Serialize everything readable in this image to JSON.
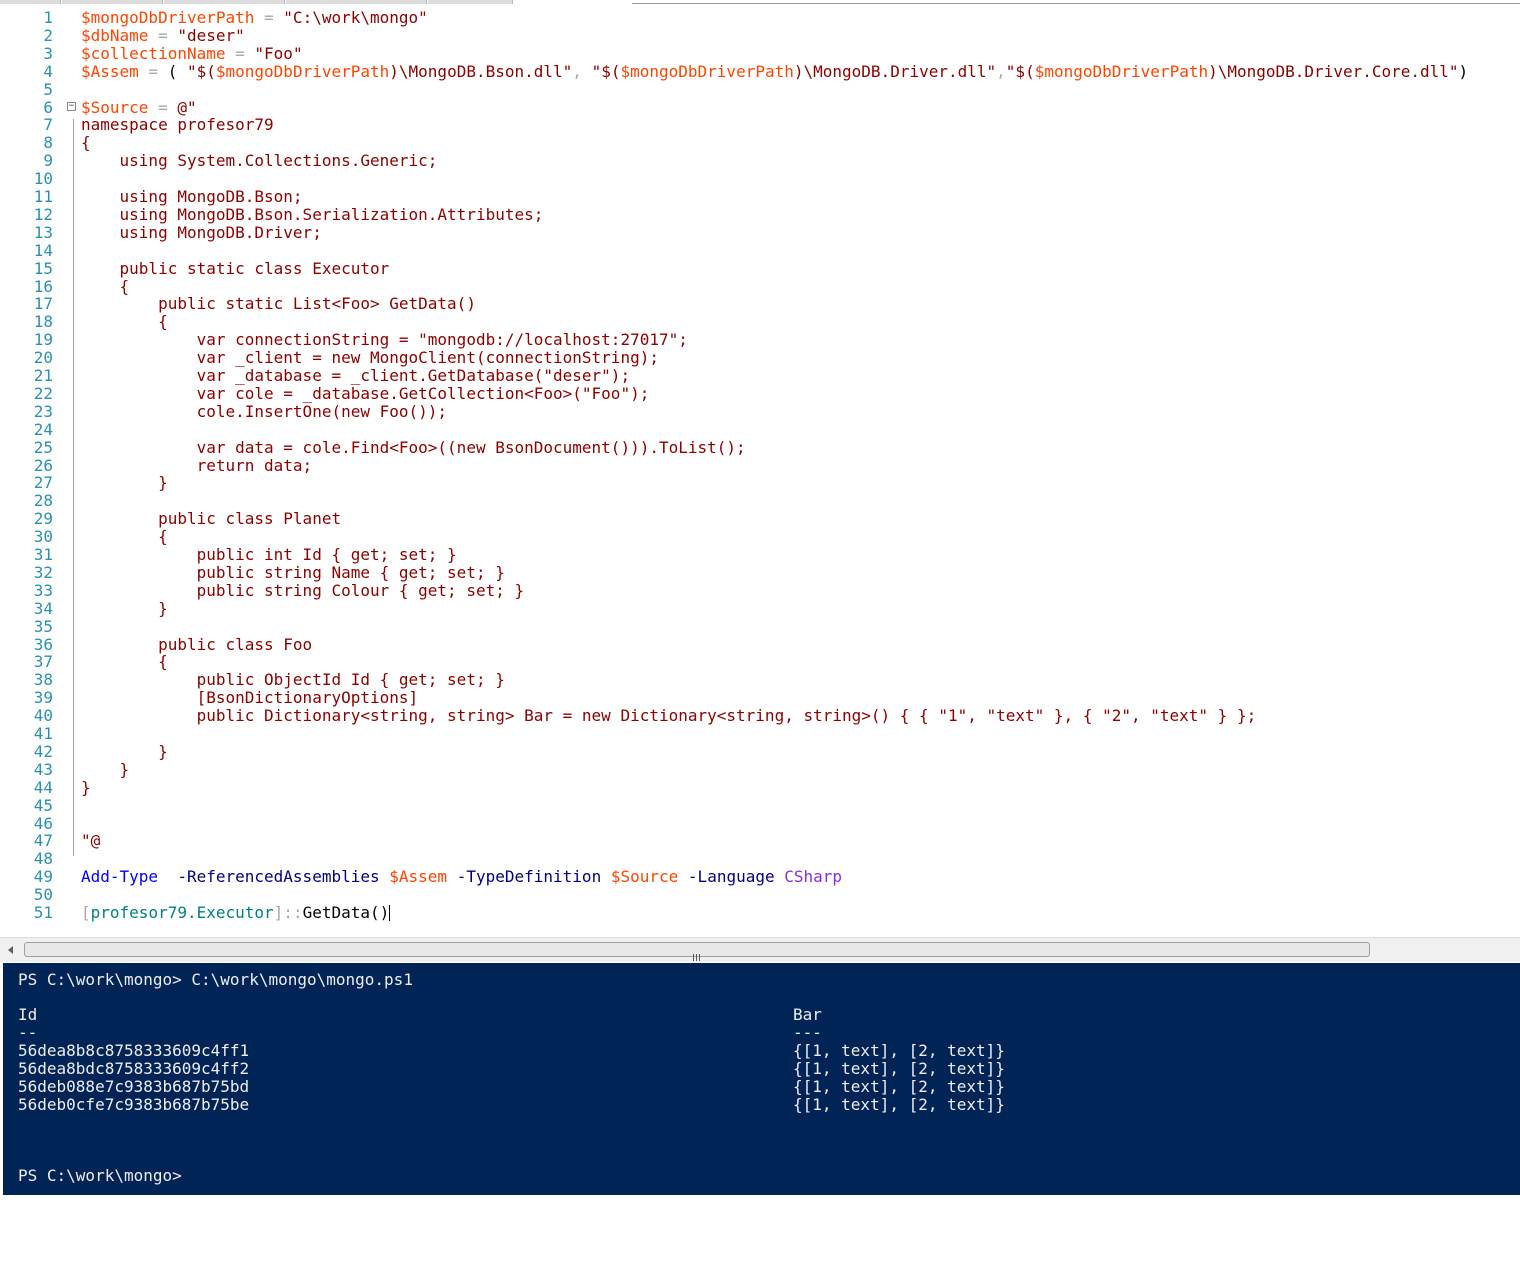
{
  "editor": {
    "lines": [
      {
        "n": "1",
        "t": [
          [
            "var",
            "$mongoDbDriverPath"
          ],
          [
            "op",
            " = "
          ],
          [
            "str",
            "\"C:\\work\\mongo\""
          ]
        ]
      },
      {
        "n": "2",
        "t": [
          [
            "var",
            "$dbName"
          ],
          [
            "op",
            " = "
          ],
          [
            "str",
            "\"deser\""
          ]
        ]
      },
      {
        "n": "3",
        "t": [
          [
            "var",
            "$collectionName"
          ],
          [
            "op",
            " = "
          ],
          [
            "str",
            "\"Foo\""
          ]
        ]
      },
      {
        "n": "4",
        "t": [
          [
            "var",
            "$Assem"
          ],
          [
            "op",
            " = "
          ],
          [
            "plain",
            "( "
          ],
          [
            "str",
            "\"$("
          ],
          [
            "var",
            "$mongoDbDriverPath"
          ],
          [
            "str",
            ")\\MongoDB.Bson.dll\""
          ],
          [
            "op",
            ", "
          ],
          [
            "str",
            "\"$("
          ],
          [
            "var",
            "$mongoDbDriverPath"
          ],
          [
            "str",
            ")\\MongoDB.Driver.dll\""
          ],
          [
            "op",
            ","
          ],
          [
            "str",
            "\"$("
          ],
          [
            "var",
            "$mongoDbDriverPath"
          ],
          [
            "str",
            ")\\MongoDB.Driver.Core.dll\""
          ],
          [
            "plain",
            ")"
          ]
        ]
      },
      {
        "n": "5",
        "t": []
      },
      {
        "n": "6",
        "t": [
          [
            "var",
            "$Source"
          ],
          [
            "op",
            " = "
          ],
          [
            "here",
            "@\""
          ]
        ]
      },
      {
        "n": "7",
        "t": [
          [
            "here",
            "namespace profesor79"
          ]
        ]
      },
      {
        "n": "8",
        "t": [
          [
            "here",
            "{"
          ]
        ]
      },
      {
        "n": "9",
        "t": [
          [
            "here",
            "    using System.Collections.Generic;"
          ]
        ]
      },
      {
        "n": "10",
        "t": []
      },
      {
        "n": "11",
        "t": [
          [
            "here",
            "    using MongoDB.Bson;"
          ]
        ]
      },
      {
        "n": "12",
        "t": [
          [
            "here",
            "    using MongoDB.Bson.Serialization.Attributes;"
          ]
        ]
      },
      {
        "n": "13",
        "t": [
          [
            "here",
            "    using MongoDB.Driver;"
          ]
        ]
      },
      {
        "n": "14",
        "t": []
      },
      {
        "n": "15",
        "t": [
          [
            "here",
            "    public static class Executor"
          ]
        ]
      },
      {
        "n": "16",
        "t": [
          [
            "here",
            "    {"
          ]
        ]
      },
      {
        "n": "17",
        "t": [
          [
            "here",
            "        public static List<Foo> GetData()"
          ]
        ]
      },
      {
        "n": "18",
        "t": [
          [
            "here",
            "        {"
          ]
        ]
      },
      {
        "n": "19",
        "t": [
          [
            "here",
            "            var connectionString = \"mongodb://localhost:27017\";"
          ]
        ]
      },
      {
        "n": "20",
        "t": [
          [
            "here",
            "            var _client = new MongoClient(connectionString);"
          ]
        ]
      },
      {
        "n": "21",
        "t": [
          [
            "here",
            "            var _database = _client.GetDatabase(\"deser\");"
          ]
        ]
      },
      {
        "n": "22",
        "t": [
          [
            "here",
            "            var cole = _database.GetCollection<Foo>(\"Foo\");"
          ]
        ]
      },
      {
        "n": "23",
        "t": [
          [
            "here",
            "            cole.InsertOne(new Foo());"
          ]
        ]
      },
      {
        "n": "24",
        "t": []
      },
      {
        "n": "25",
        "t": [
          [
            "here",
            "            var data = cole.Find<Foo>((new BsonDocument())).ToList();"
          ]
        ]
      },
      {
        "n": "26",
        "t": [
          [
            "here",
            "            return data;"
          ]
        ]
      },
      {
        "n": "27",
        "t": [
          [
            "here",
            "        }"
          ]
        ]
      },
      {
        "n": "28",
        "t": []
      },
      {
        "n": "29",
        "t": [
          [
            "here",
            "        public class Planet"
          ]
        ]
      },
      {
        "n": "30",
        "t": [
          [
            "here",
            "        {"
          ]
        ]
      },
      {
        "n": "31",
        "t": [
          [
            "here",
            "            public int Id { get; set; }"
          ]
        ]
      },
      {
        "n": "32",
        "t": [
          [
            "here",
            "            public string Name { get; set; }"
          ]
        ]
      },
      {
        "n": "33",
        "t": [
          [
            "here",
            "            public string Colour { get; set; }"
          ]
        ]
      },
      {
        "n": "34",
        "t": [
          [
            "here",
            "        }"
          ]
        ]
      },
      {
        "n": "35",
        "t": []
      },
      {
        "n": "36",
        "t": [
          [
            "here",
            "        public class Foo"
          ]
        ]
      },
      {
        "n": "37",
        "t": [
          [
            "here",
            "        {"
          ]
        ]
      },
      {
        "n": "38",
        "t": [
          [
            "here",
            "            public ObjectId Id { get; set; }"
          ]
        ]
      },
      {
        "n": "39",
        "t": [
          [
            "here",
            "            [BsonDictionaryOptions]"
          ]
        ]
      },
      {
        "n": "40",
        "t": [
          [
            "here",
            "            public Dictionary<string, string> Bar = new Dictionary<string, string>() { { \"1\", \"text\" }, { \"2\", \"text\" } };"
          ]
        ]
      },
      {
        "n": "41",
        "t": []
      },
      {
        "n": "42",
        "t": [
          [
            "here",
            "        }"
          ]
        ]
      },
      {
        "n": "43",
        "t": [
          [
            "here",
            "    }"
          ]
        ]
      },
      {
        "n": "44",
        "t": [
          [
            "here",
            "}"
          ]
        ]
      },
      {
        "n": "45",
        "t": []
      },
      {
        "n": "46",
        "t": []
      },
      {
        "n": "47",
        "t": [
          [
            "here",
            "\"@"
          ]
        ]
      },
      {
        "n": "48",
        "t": []
      },
      {
        "n": "49",
        "t": [
          [
            "cmd",
            "Add-Type"
          ],
          [
            "plain",
            "  "
          ],
          [
            "param",
            "-ReferencedAssemblies"
          ],
          [
            "plain",
            " "
          ],
          [
            "var",
            "$Assem"
          ],
          [
            "plain",
            " "
          ],
          [
            "param",
            "-TypeDefinition"
          ],
          [
            "plain",
            " "
          ],
          [
            "var",
            "$Source"
          ],
          [
            "plain",
            " "
          ],
          [
            "param",
            "-Language"
          ],
          [
            "plain",
            " "
          ],
          [
            "cmdarg",
            "CSharp"
          ]
        ]
      },
      {
        "n": "50",
        "t": []
      },
      {
        "n": "51",
        "t": [
          [
            "op",
            "["
          ],
          [
            "type",
            "profesor79.Executor"
          ],
          [
            "op",
            "]::"
          ],
          [
            "plain",
            "GetData()"
          ]
        ]
      }
    ]
  },
  "console": {
    "prompt_cmd": "PS C:\\work\\mongo> C:\\work\\mongo\\mongo.ps1",
    "col_headers": [
      "Id",
      "Bar"
    ],
    "col_underlines": [
      "--",
      "---"
    ],
    "rows": [
      [
        "56dea8b8c8758333609c4ff1",
        "{[1, text], [2, text]}"
      ],
      [
        "56dea8bdc8758333609c4ff2",
        "{[1, text], [2, text]}"
      ],
      [
        "56deb088e7c9383b687b75bd",
        "{[1, text], [2, text]}"
      ],
      [
        "56deb0cfe7c9383b687b75be",
        "{[1, text], [2, text]}"
      ]
    ],
    "final_prompt": "PS C:\\work\\mongo>"
  },
  "colors": {
    "variable": "#ff4500",
    "operator": "#a9a9a9",
    "string": "#8b0000",
    "command": "#0000ff",
    "parameter": "#000080",
    "command_argument": "#8a2be2",
    "type": "#008080",
    "line_number": "#2b91af",
    "console_bg": "#012456",
    "console_fg": "#eeedf0"
  }
}
